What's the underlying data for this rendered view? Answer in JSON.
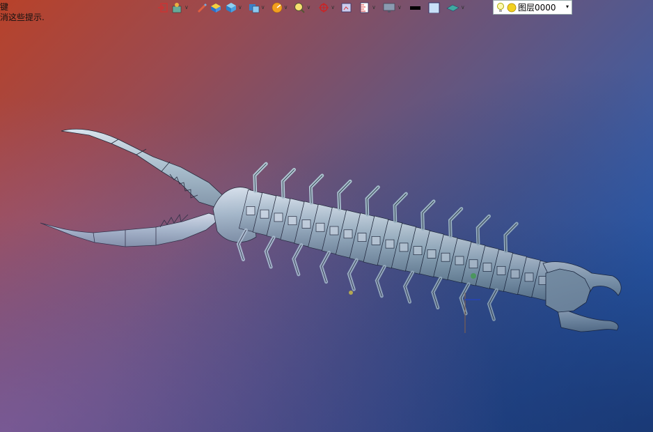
{
  "hints": {
    "line1": "键",
    "line2": "消这些提示."
  },
  "toolbar": {
    "icons": [
      "exit-icon",
      "layer-move-icon",
      "pencil-icon",
      "box-yellow-icon",
      "cube-icon",
      "copy-solid-icon",
      "dial-icon",
      "zoom-fit-icon",
      "target-icon",
      "frame-icon",
      "ruler-icon",
      "monitor-icon",
      "color-black-icon",
      "color-white-icon",
      "surface-icon"
    ],
    "dropdown_arrow": "∨"
  },
  "layer_selector": {
    "value": "图层0000",
    "arrow": "▾"
  },
  "colors": {
    "bg_top_left": "#b8422a",
    "bg_top_right": "#2a70d0",
    "model_fill": "#b4cdd6",
    "model_edge": "#1c2430"
  }
}
